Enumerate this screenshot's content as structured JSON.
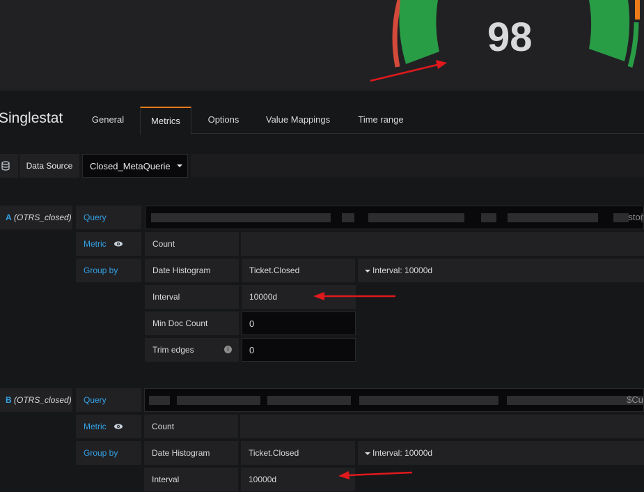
{
  "panel": {
    "stat_value": "98",
    "gauge_fraction": 0.98
  },
  "editor": {
    "title": "Singlestat",
    "tabs": [
      {
        "label": "General",
        "active": false
      },
      {
        "label": "Metrics",
        "active": true
      },
      {
        "label": "Options",
        "active": false
      },
      {
        "label": "Value Mappings",
        "active": false
      },
      {
        "label": "Time range",
        "active": false
      }
    ]
  },
  "datasource": {
    "label": "Data Source",
    "value": "Closed_MetaQuerie"
  },
  "queries": [
    {
      "ref": "A",
      "name": "(OTRS_closed)",
      "query_label": "Query",
      "query_tail": "stor",
      "metric_label": "Metric",
      "metric_value": "Count",
      "groupby_label": "Group by",
      "groupby_type": "Date Histogram",
      "groupby_field": "Ticket.Closed",
      "groupby_interval": "Interval: 10000d",
      "interval_label": "Interval",
      "interval_value": "10000d",
      "mindoc_label": "Min Doc Count",
      "mindoc_value": "0",
      "trim_label": "Trim edges",
      "trim_value": "0"
    },
    {
      "ref": "B",
      "name": "(OTRS_closed)",
      "query_label": "Query",
      "query_tail": "$Cu",
      "metric_label": "Metric",
      "metric_value": "Count",
      "groupby_label": "Group by",
      "groupby_type": "Date Histogram",
      "groupby_field": "Ticket.Closed",
      "groupby_interval": "Interval: 10000d",
      "interval_label": "Interval",
      "interval_value": "10000d"
    }
  ],
  "colors": {
    "accent_blue": "#33a2e5",
    "tab_accent": "#eb7b18",
    "gauge_green": "#299c46",
    "gauge_red": "#d44a3a",
    "arrow_red": "#e0191c"
  },
  "icons": [
    "database-icon",
    "caret-down-icon",
    "eye-icon",
    "info-icon"
  ]
}
